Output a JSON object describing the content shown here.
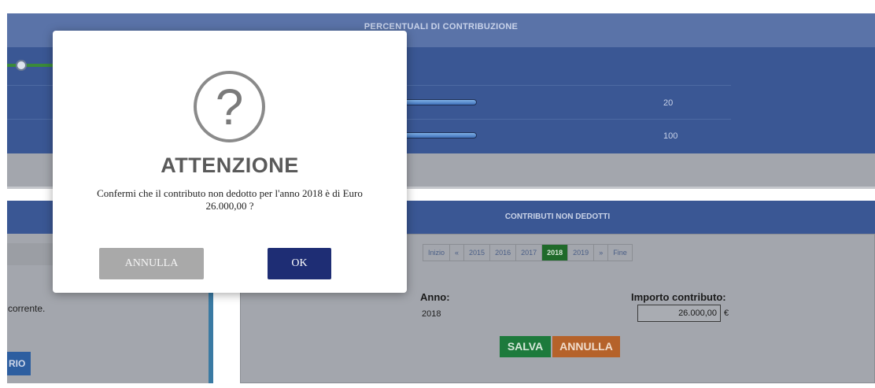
{
  "percentuali": {
    "header": "PERCENTUALI DI CONTRIBUZIONE",
    "rows": [
      {
        "value": "20"
      },
      {
        "value": "100"
      }
    ]
  },
  "left_panel": {
    "text": "corrente.",
    "button_label": "RIO"
  },
  "contributi": {
    "header": "CONTRIBUTI NON DEDOTTI",
    "pager": [
      "Inizio",
      "«",
      "2015",
      "2016",
      "2017",
      "2018",
      "2019",
      "»",
      "Fine"
    ],
    "active_page": "2018",
    "anno_label": "Anno:",
    "anno_value": "2018",
    "importo_label": "Importo contributo:",
    "importo_value": "26.000,00",
    "currency": "€",
    "save_label": "SALVA",
    "cancel_label": "ANNULLA"
  },
  "modal": {
    "icon": "question-icon",
    "icon_glyph": "?",
    "title": "ATTENZIONE",
    "message": "Confermi che il contributo non dedotto per l'anno 2018 è di Euro 26.000,00 ?",
    "cancel_label": "ANNULLA",
    "ok_label": "OK"
  },
  "colors": {
    "header_blue": "#3a5794",
    "ok_button": "#1e2d74",
    "cancel_button": "#a9a9a9",
    "save_green": "#1d7a3c",
    "annulla_orange": "#b5622a",
    "active_page": "#1f6a2a"
  }
}
